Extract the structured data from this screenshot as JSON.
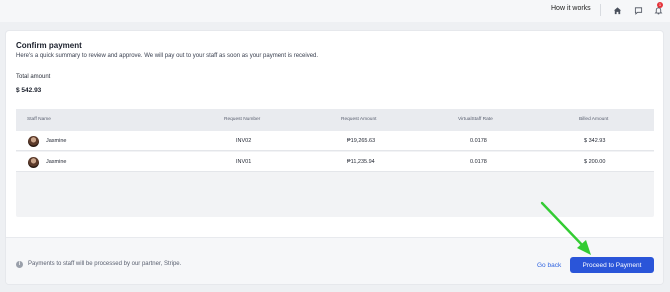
{
  "header": {
    "how_it_works": "How it works",
    "notification_count": "1"
  },
  "page": {
    "title": "Confirm payment",
    "subtitle": "Here's a quick summary to review and approve. We will pay out to your staff as soon as your payment is received.",
    "total_label": "Total amount",
    "total_value": "$ 542.93"
  },
  "table": {
    "columns": [
      "Staff Name",
      "Request Number",
      "Request Amount",
      "VirtualStaff Rate",
      "Billed Amount"
    ],
    "rows": [
      {
        "name": "Jasmine",
        "request_number": "INV02",
        "request_amount": "₱19,265.63",
        "rate": "0.0178",
        "billed": "$ 342.93"
      },
      {
        "name": "Jasmine",
        "request_number": "INV01",
        "request_amount": "₱11,235.94",
        "rate": "0.0178",
        "billed": "$ 200.00"
      }
    ]
  },
  "footer": {
    "note": "Payments to staff will be processed by our partner, Stripe.",
    "go_back": "Go back",
    "proceed": "Proceed to Payment"
  },
  "colors": {
    "primary": "#2a55d9",
    "link": "#2f63e0",
    "annotation_arrow": "#33cc33",
    "badge": "#e5333b"
  },
  "icons": [
    "home-icon",
    "chat-icon",
    "bell-icon",
    "info-icon",
    "avatar"
  ]
}
